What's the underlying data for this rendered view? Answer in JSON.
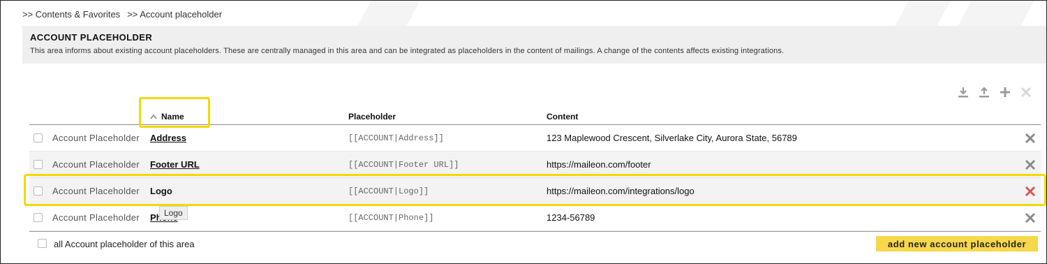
{
  "breadcrumb": [
    ">> Contents & Favorites",
    ">> Account placeholder"
  ],
  "info": {
    "title": "ACCOUNT PLACEHOLDER",
    "description": "This area informs about existing account placeholders. These are centrally managed in this area and can be integrated as placeholders in the content of mailings. A change of the contents affects existing integrations."
  },
  "toolbar": {
    "icons": [
      "download-icon",
      "upload-icon",
      "plus-icon",
      "close-icon"
    ]
  },
  "table": {
    "headers": {
      "name": "Name",
      "placeholder": "Placeholder",
      "content": "Content"
    },
    "sort_indicator": "ascending",
    "rows": [
      {
        "type": "Account Placeholder",
        "name": "Address",
        "placeholder": "[[ACCOUNT|Address]]",
        "content": "123 Maplewood Crescent, Silverlake City, Aurora State, 56789"
      },
      {
        "type": "Account Placeholder",
        "name": "Footer URL",
        "placeholder": "[[ACCOUNT|Footer URL]]",
        "content": "https://maileon.com/footer"
      },
      {
        "type": "Account Placeholder",
        "name": "Logo",
        "placeholder": "[[ACCOUNT|Logo]]",
        "content": "https://maileon.com/integrations/logo"
      },
      {
        "type": "Account Placeholder",
        "name": "Phone",
        "placeholder": "[[ACCOUNT|Phone]]",
        "content": "1234-56789"
      }
    ]
  },
  "footer": {
    "select_all_label": "all Account placeholder of this area",
    "add_button_label": "add new account placeholder"
  },
  "tooltip": "Logo",
  "colors": {
    "highlight": "#f5d800",
    "button": "#f7d84a",
    "delete_active": "#d9534f",
    "delete": "#8a8a8a"
  }
}
